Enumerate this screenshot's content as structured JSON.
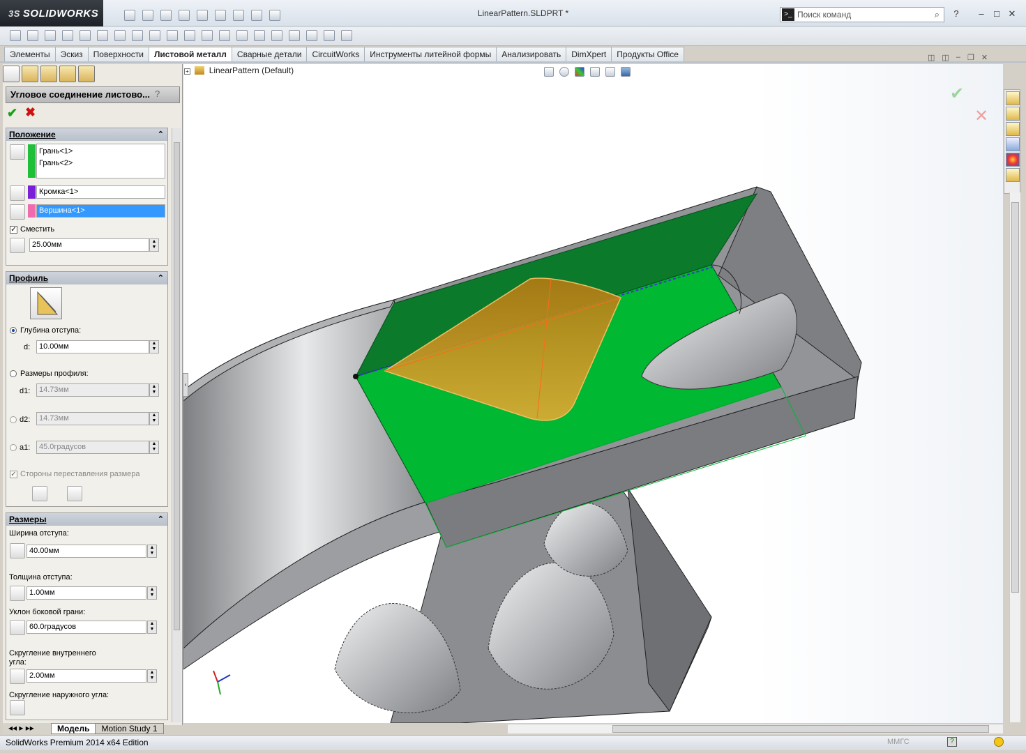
{
  "app": {
    "name": "SOLIDWORKS",
    "doc_title": "LinearPattern.SLDPRT *"
  },
  "search": {
    "placeholder": "Поиск команд"
  },
  "tabs": [
    "Элементы",
    "Эскиз",
    "Поверхности",
    "Листовой металл",
    "Сварные детали",
    "CircuitWorks",
    "Инструменты литейной формы",
    "Анализировать",
    "DimXpert",
    "Продукты Office"
  ],
  "active_tab": "Листовой металл",
  "property_manager": {
    "title": "Угловое соединение листово...",
    "position": {
      "header": "Положение",
      "faces": [
        "Грань<1>",
        "Грань<2>"
      ],
      "edge": "Кромка<1>",
      "vertex": "Вершина<1>",
      "offset_label": "Сместить",
      "offset_value": "25.00мм"
    },
    "profile": {
      "header": "Профиль",
      "depth_label": "Глубина отступа:",
      "d_label": "d:",
      "d_value": "10.00мм",
      "profile_dims_label": "Размеры профиля:",
      "d1_label": "d1:",
      "d1_value": "14.73мм",
      "d2_label": "d2:",
      "d2_value": "14.73мм",
      "a1_label": "a1:",
      "a1_value": "45.0градусов",
      "swap_label": "Стороны переставления размера"
    },
    "dimensions": {
      "header": "Размеры",
      "width_label": "Ширина отступа:",
      "width_value": "40.00мм",
      "thickness_label": "Толщина отступа:",
      "thickness_value": "1.00мм",
      "side_angle_label": "Уклон боковой грани:",
      "side_angle_value": "60.0градусов",
      "inner_fillet_label": "Скругление внутреннего угла:",
      "inner_fillet_value": "2.00мм",
      "outer_fillet_label": "Скругление наружного угла:"
    }
  },
  "tree": {
    "item": "LinearPattern  (Default)"
  },
  "bottom_tabs": [
    "Модель",
    "Motion Study 1"
  ],
  "status": {
    "edition": "SolidWorks Premium 2014 x64 Edition",
    "units": "ММГС"
  },
  "colors": {
    "face_green": "#00b832",
    "dark_green": "#0a7a28",
    "rib_orange": "#d99a1e",
    "metal_gray": "#8c8e91",
    "accent_blue": "#3399ff"
  }
}
